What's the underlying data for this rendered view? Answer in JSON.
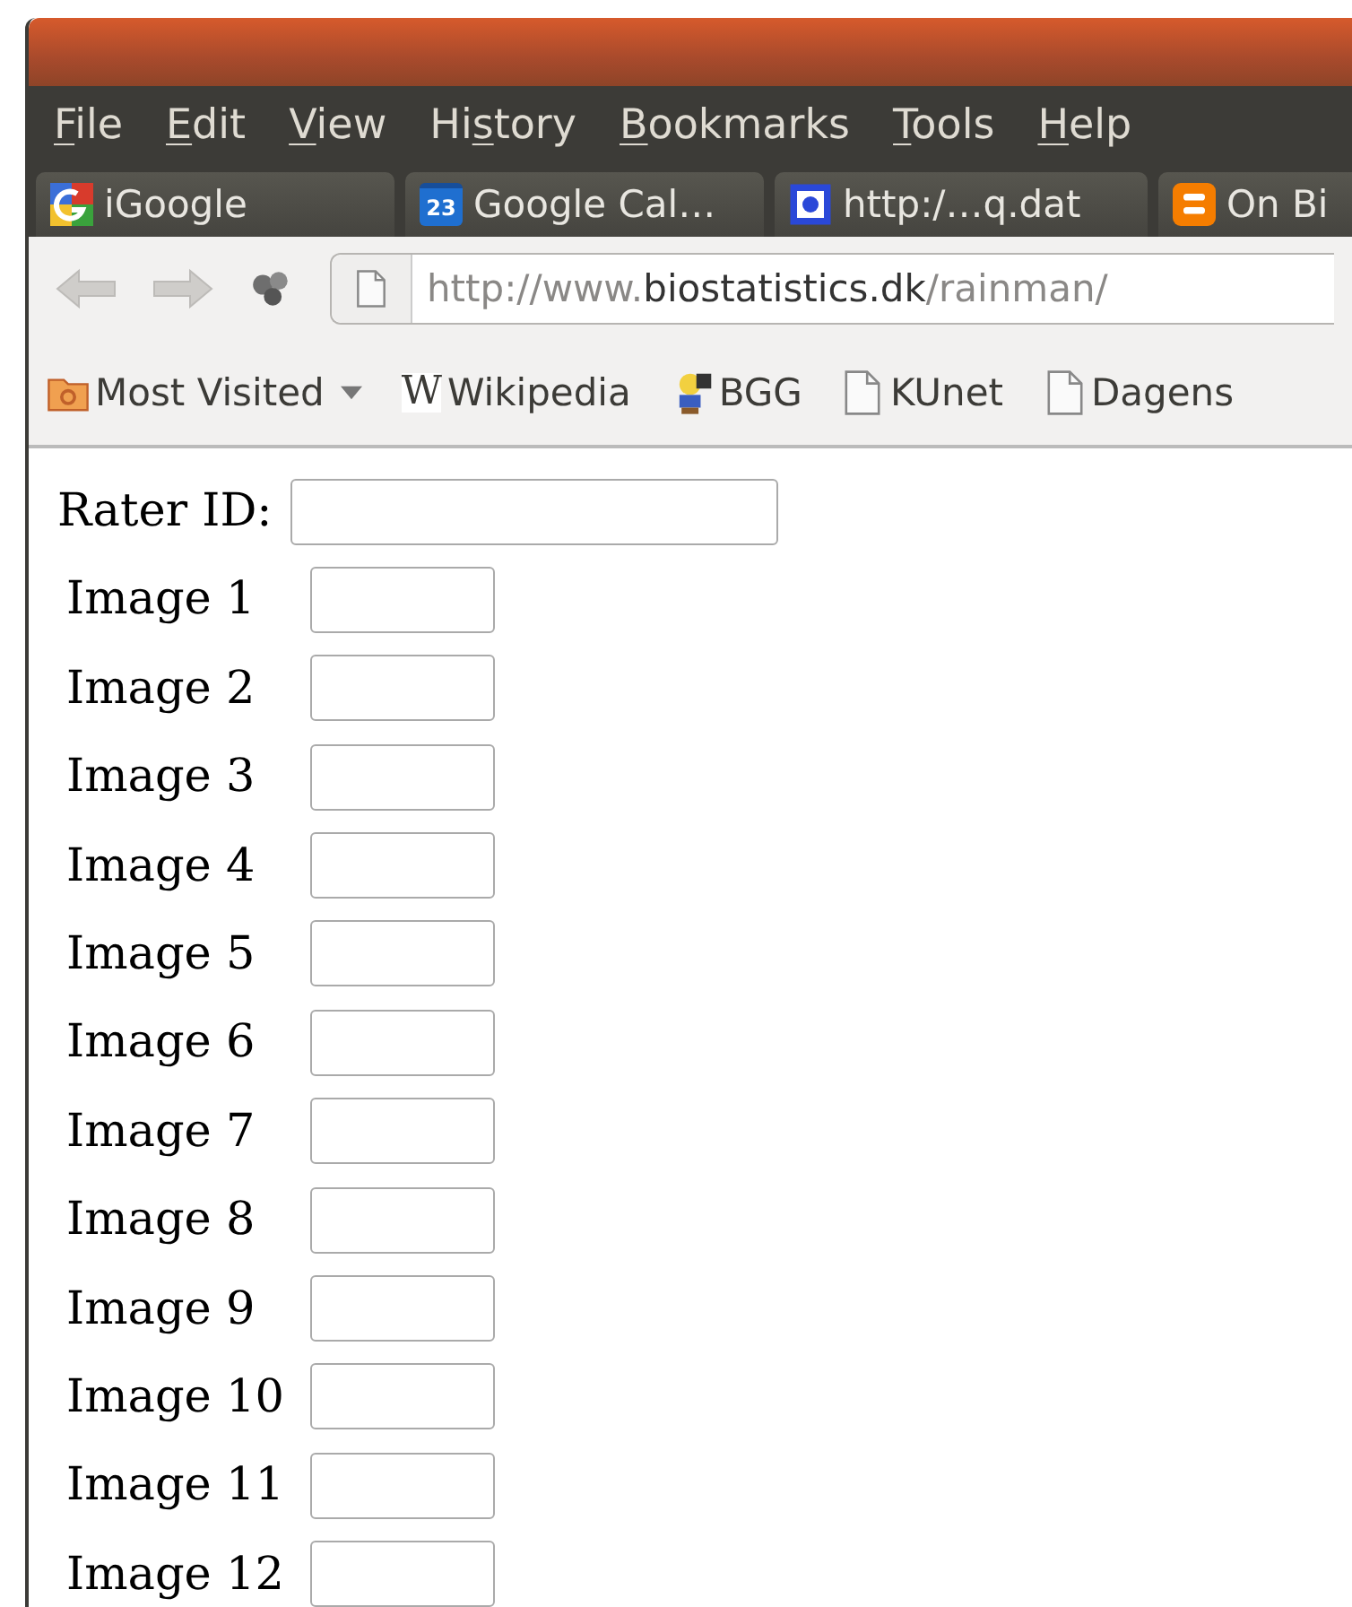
{
  "menu": [
    {
      "key": "F",
      "after": "ile"
    },
    {
      "key": "E",
      "after": "dit"
    },
    {
      "key": "V",
      "after": "iew"
    },
    {
      "before": "Hi",
      "key": "s",
      "after": "tory"
    },
    {
      "key": "B",
      "after": "ookmarks"
    },
    {
      "key": "T",
      "after": "ools"
    },
    {
      "key": "H",
      "after": "elp"
    }
  ],
  "tabs": [
    {
      "kind": "google",
      "label": "iGoogle"
    },
    {
      "kind": "calendar",
      "icon_text": "23",
      "label": "Google Cal…"
    },
    {
      "kind": "document",
      "label": "http:/…q.dat"
    },
    {
      "kind": "blogger",
      "label": "On Bi"
    }
  ],
  "address": {
    "prefix": "http://www.",
    "host": "biostatistics.dk",
    "path": "/rainman/"
  },
  "bookmarks": [
    {
      "kind": "folder",
      "label": "Most Visited"
    },
    {
      "kind": "wiki",
      "icon_text": "W",
      "label": "Wikipedia"
    },
    {
      "kind": "figure",
      "label": "BGG"
    },
    {
      "kind": "page",
      "label": "KUnet"
    },
    {
      "kind": "page",
      "label": "Dagens"
    }
  ],
  "form": {
    "rater_label": "Rater ID:",
    "images": [
      "Image 1",
      "Image 2",
      "Image 3",
      "Image 4",
      "Image 5",
      "Image 6",
      "Image 7",
      "Image 8",
      "Image 9",
      "Image 10",
      "Image 11",
      "Image 12"
    ]
  }
}
